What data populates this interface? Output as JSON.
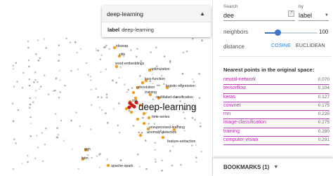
{
  "selection": {
    "title": "deep-learning",
    "field_key": "label",
    "field_value": "deep-learning"
  },
  "panel": {
    "search_label": "Search",
    "search_value": "dee",
    "regex_glyph": ".*",
    "by_label": "by",
    "by_value": "label",
    "neighbors_label": "neighbors",
    "neighbors_value": "100",
    "neighbors_fraction": 1.0,
    "distance_label": "distance",
    "distance_options": [
      "COSINE",
      "EUCLIDEAN"
    ],
    "distance_selected": "COSINE",
    "nn_title": "Nearest points in the original space:",
    "neighbors": [
      {
        "word": "neural-network",
        "dist": "0.070"
      },
      {
        "word": "tensorflow",
        "dist": "0.104"
      },
      {
        "word": "keras",
        "dist": "0.127"
      },
      {
        "word": "convnet",
        "dist": "0.175"
      },
      {
        "word": "rnn",
        "dist": "0.225"
      },
      {
        "word": "image-classification",
        "dist": "0.275"
      },
      {
        "word": "training",
        "dist": "0.280"
      },
      {
        "word": "computer-vision",
        "dist": "0.291"
      }
    ],
    "bookmarks_label": "BOOKMARKS (1)"
  },
  "scatter": {
    "focus_label": "deep-learning",
    "labels": [
      "idearap",
      "nltk",
      "word-embeddings",
      "optimization",
      "loss-function",
      "logistic-regression",
      "convolution",
      "training",
      "multilabel-classification",
      "rnn",
      "time-series",
      "unsupervised-learning",
      "anomaly-detection",
      "feature-extraction",
      "gan",
      "lstm",
      "apache-spark"
    ]
  },
  "colors": {
    "accent": "#3f76c8",
    "cosine": "#1e7bd8",
    "neighbor": "#b52aa9",
    "point_grey": "#b4b4b4",
    "point_orange": "#f0a020",
    "point_red": "#d01818"
  }
}
